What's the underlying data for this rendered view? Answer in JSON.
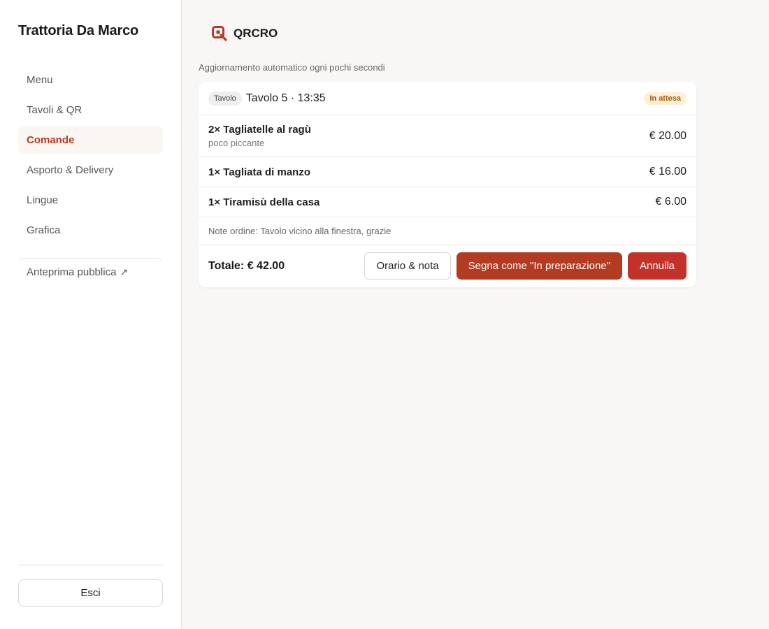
{
  "sidebar": {
    "restaurant_name": "Trattoria Da Marco",
    "items": [
      {
        "label": "Menu",
        "active": false
      },
      {
        "label": "Tavoli & QR",
        "active": false
      },
      {
        "label": "Comande",
        "active": true
      },
      {
        "label": "Asporto & Delivery",
        "active": false
      },
      {
        "label": "Lingue",
        "active": false
      },
      {
        "label": "Grafica",
        "active": false
      }
    ],
    "public_preview": "Anteprima pubblica",
    "public_preview_icon": "external-link-arrow-icon",
    "logout_label": "Esci"
  },
  "header": {
    "logo_text": "QRCRO",
    "logo_icon": "qr-logo-icon",
    "logo_color": "#b23b22"
  },
  "main": {
    "refresh_note": "Aggiornamento automatico ogni pochi secondi",
    "order": {
      "table_chip": "Tavolo",
      "title": "Tavolo 5 · 13:35",
      "status": "In attesa",
      "items": [
        {
          "name": "2× Tagliatelle al ragù",
          "note": "poco piccante",
          "price": "€ 20.00"
        },
        {
          "name": "1× Tagliata di manzo",
          "note": "",
          "price": "€ 16.00"
        },
        {
          "name": "1× Tiramisù della casa",
          "note": "",
          "price": "€ 6.00"
        }
      ],
      "order_note": "Note ordine: Tavolo vicino alla finestra, grazie",
      "total": "Totale: € 42.00",
      "actions": {
        "schedule_note": "Orario & nota",
        "mark_preparing": "Segna come \"In preparazione\"",
        "cancel": "Annulla"
      }
    }
  },
  "colors": {
    "accent": "#b23b22",
    "danger": "#c2322a",
    "status_pending_bg": "#fdf0d8",
    "status_pending_text": "#a35a0a"
  }
}
